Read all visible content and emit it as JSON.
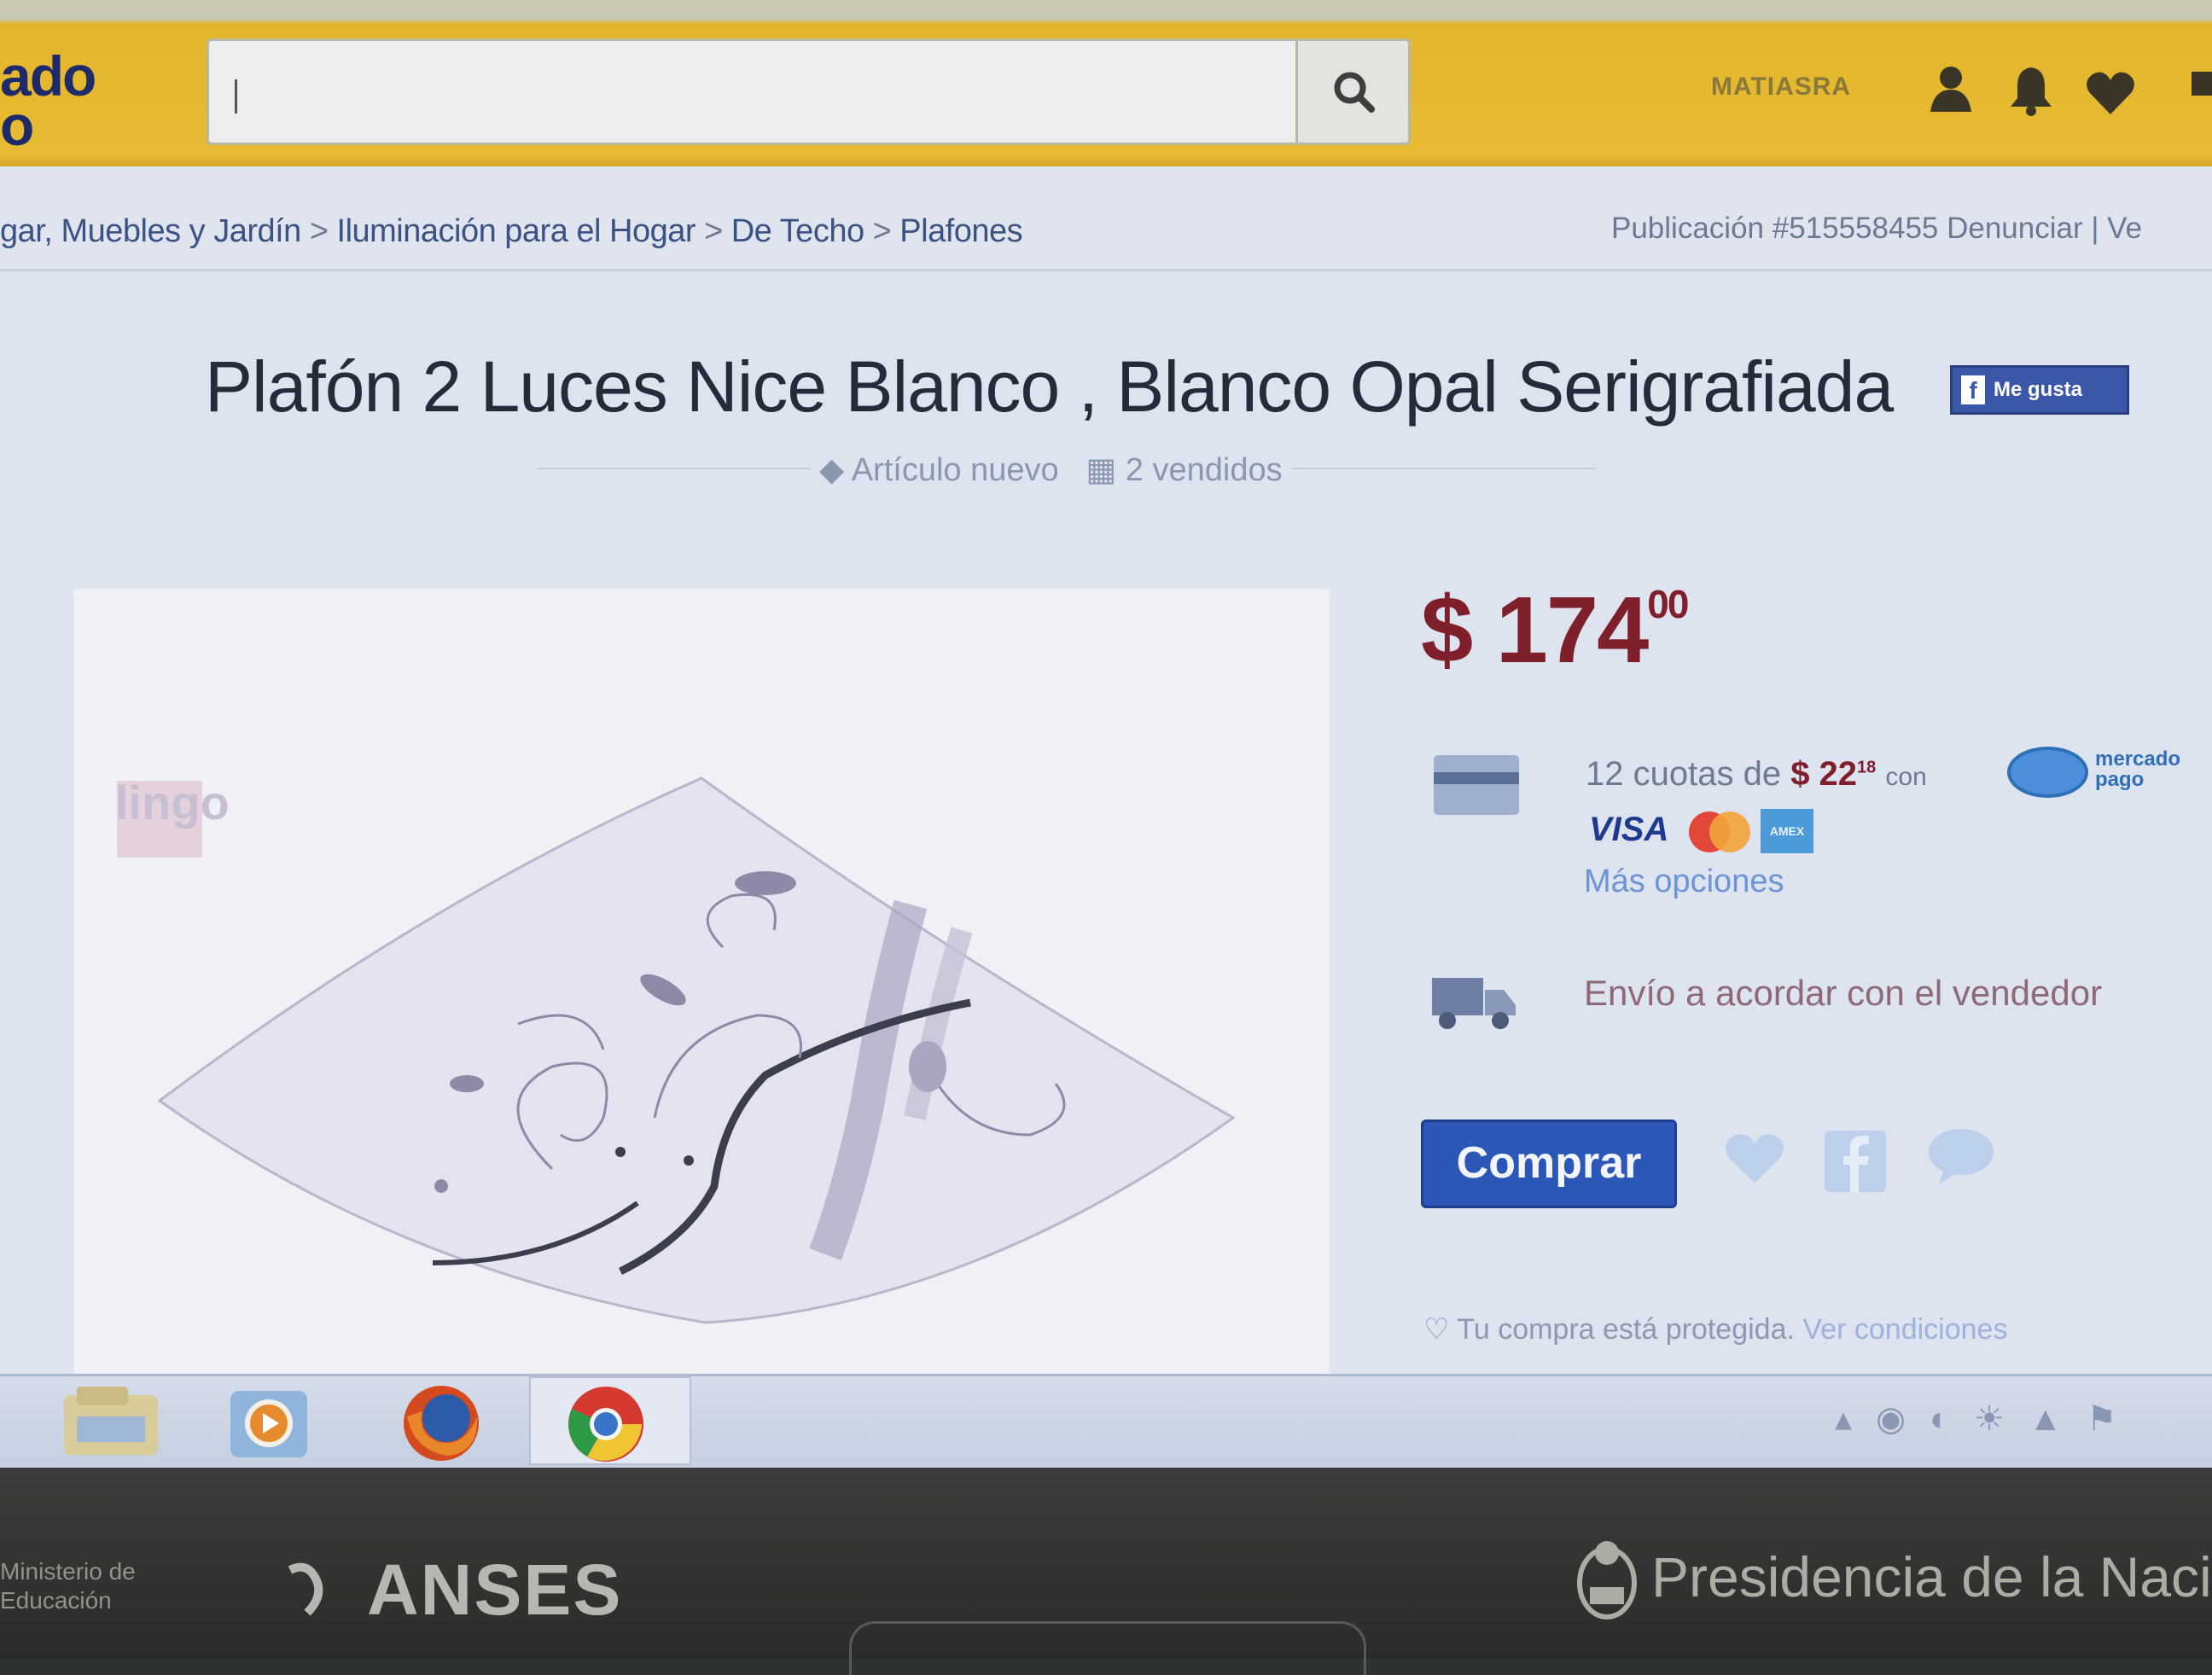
{
  "header": {
    "logo_text": "ado\no",
    "search": {
      "value": "",
      "placeholder": ""
    },
    "username": "MATIASRA",
    "icons": [
      "user-icon",
      "bell-icon",
      "heart-icon"
    ],
    "accent_color": "#e7bb33"
  },
  "breadcrumb": {
    "items": [
      "gar, Muebles y Jardín",
      "Iluminación para el Hogar",
      "De Techo",
      "Plafones"
    ],
    "separator": ">",
    "publication": "Publicación #515558455 Denunciar | Ve"
  },
  "product": {
    "title": "Plafón 2 Luces Nice Blanco , Blanco Opal Serigrafiada",
    "like_label": "Me gusta",
    "condition": "Artículo nuevo",
    "sold": "2 vendidos",
    "watermark": "lingo",
    "price_integer": "$ 174",
    "price_cents": "00",
    "installments_prefix": "12 cuotas de",
    "installment_amount": "$ 22",
    "installment_cents": "18",
    "installments_suffix": "con",
    "mp_label": "mercado pago",
    "card_brands": [
      "VISA",
      "mastercard",
      "AMEX"
    ],
    "more_options": "Más opciones",
    "shipping": "Envío a acordar con el vendedor",
    "buy_label": "Comprar",
    "protected_text": "Tu compra está protegida.",
    "protected_link": "Ver condiciones",
    "price_color": "#7e1f2b",
    "button_color": "#2c57b8"
  },
  "taskbar": {
    "items": [
      "file-explorer-icon",
      "media-player-icon",
      "firefox-icon",
      "chrome-icon"
    ],
    "tray_icons": [
      "arrow-up-icon",
      "network-icon",
      "speaker-icon",
      "battery-icon",
      "flag-icon"
    ]
  },
  "bezel": {
    "left_text": "Ministerio de\nEducación",
    "anses": "ANSES",
    "presidencia": "Presidencia de la Naci"
  }
}
